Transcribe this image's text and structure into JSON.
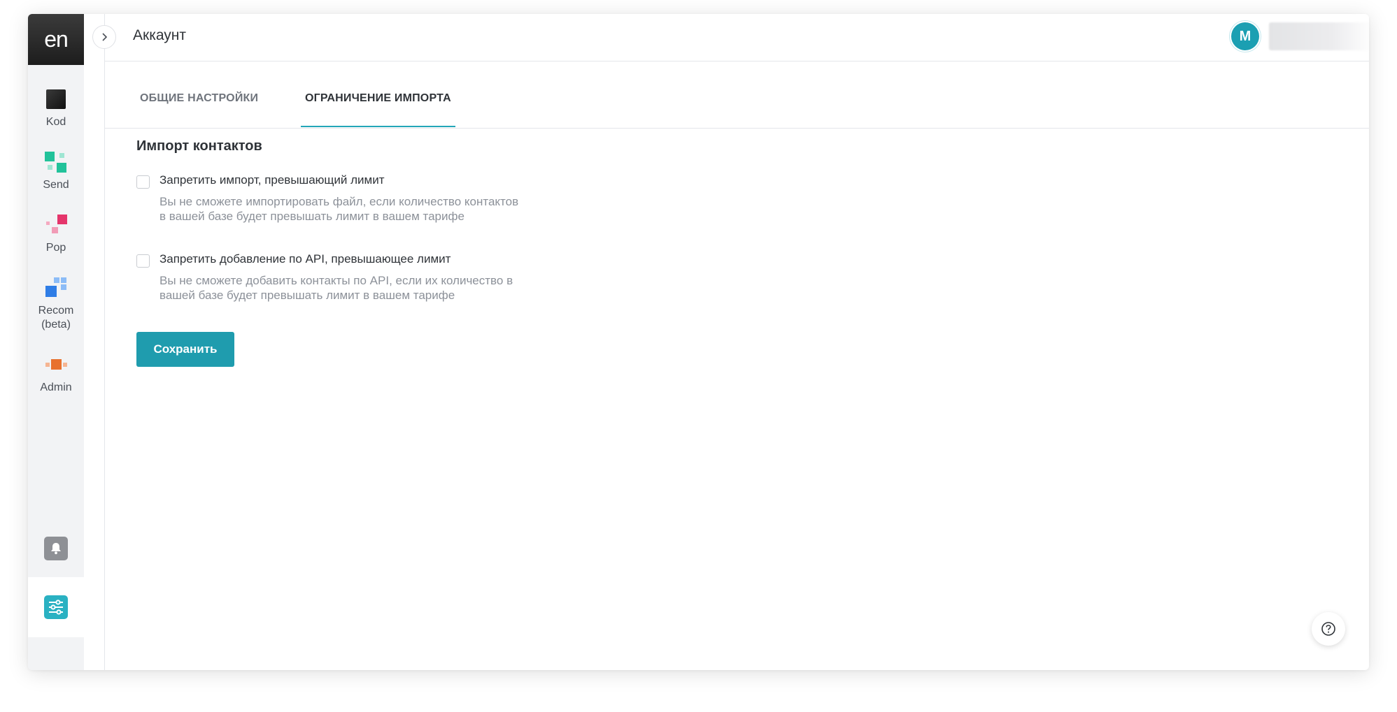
{
  "logo": {
    "text": "en"
  },
  "sidebar": {
    "items": [
      {
        "label": "Kod",
        "icon": "kod-icon"
      },
      {
        "label": "Send",
        "icon": "send-icon"
      },
      {
        "label": "Pop",
        "icon": "pop-icon"
      },
      {
        "label": "Recom\n(beta)",
        "icon": "recom-icon"
      },
      {
        "label": "Admin",
        "icon": "admin-icon"
      }
    ],
    "bell_icon": "bell-icon",
    "settings_icon": "settings-sliders-icon"
  },
  "header": {
    "title": "Аккаунт",
    "avatar_initial": "M"
  },
  "tabs": [
    {
      "label": "ОБЩИЕ НАСТРОЙКИ",
      "active": false
    },
    {
      "label": "ОГРАНИЧЕНИЕ ИМПОРТА",
      "active": true
    }
  ],
  "content": {
    "section_title": "Импорт контактов",
    "options": [
      {
        "label": "Запретить импорт, превышающий лимит",
        "description_lines": [
          "Вы не сможете импортировать файл, если количество контактов",
          "в вашей базе будет превышать лимит в вашем тарифе"
        ],
        "checked": false
      },
      {
        "label": "Запретить добавление по API, превышающее лимит",
        "description_lines": [
          "Вы не сможете добавить контакты по API, если их количество в",
          "вашей базе будет превышать лимит в вашем тарифе"
        ],
        "checked": false
      }
    ],
    "save_label": "Сохранить"
  },
  "help": {
    "icon": "help-question-icon"
  },
  "colors": {
    "accent": "#1f9cae",
    "sidebar_bg": "#f2f3f5",
    "logo_bg": "#262626"
  }
}
